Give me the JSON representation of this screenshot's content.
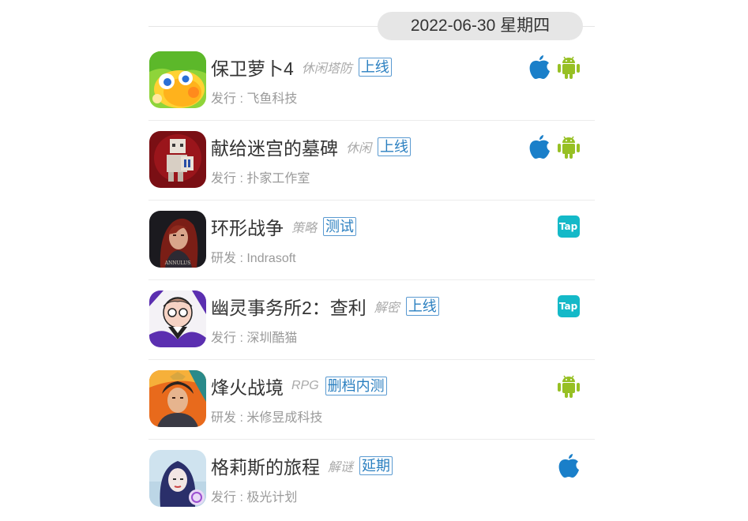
{
  "header": {
    "date_label": "2022-06-30 星期四"
  },
  "games": [
    {
      "name": "保卫萝卜4",
      "genre": "休闲塔防",
      "status": "上线",
      "credit_label": "发行",
      "credit_value": "飞鱼科技",
      "icon": "carrot-game-icon",
      "platforms": [
        "apple",
        "android"
      ]
    },
    {
      "name": "献给迷宫的墓碑",
      "genre": "休闲",
      "status": "上线",
      "credit_label": "发行",
      "credit_value": "扑家工作室",
      "icon": "tombstone-pixel-icon",
      "platforms": [
        "apple",
        "android"
      ]
    },
    {
      "name": "环形战争",
      "genre": "策略",
      "status": "测试",
      "credit_label": "研发",
      "credit_value": "Indrasoft",
      "icon": "annulus-icon",
      "icon_text": "ANNULUS",
      "platforms": [
        "taptap"
      ]
    },
    {
      "name": "幽灵事务所2：查利",
      "genre": "解密",
      "status": "上线",
      "credit_label": "发行",
      "credit_value": "深圳酷猫",
      "icon": "ghost-office-icon",
      "platforms": [
        "taptap"
      ]
    },
    {
      "name": "烽火战境",
      "genre": "RPG",
      "status": "删档内测",
      "credit_label": "研发",
      "credit_value": "米修昱成科技",
      "icon": "warrior-portrait-icon",
      "platforms": [
        "android"
      ]
    },
    {
      "name": "格莉斯的旅程",
      "genre": "解谜",
      "status": "延期",
      "credit_label": "发行",
      "credit_value": "极光计划",
      "icon": "gris-journey-icon",
      "platforms": [
        "apple"
      ]
    }
  ],
  "platform_labels": {
    "taptap": "Tap"
  },
  "colors": {
    "status_blue": "#2a7fc0",
    "apple_blue": "#1a7fc9",
    "android_green": "#97c024",
    "taptap_teal": "#14b9c8"
  }
}
